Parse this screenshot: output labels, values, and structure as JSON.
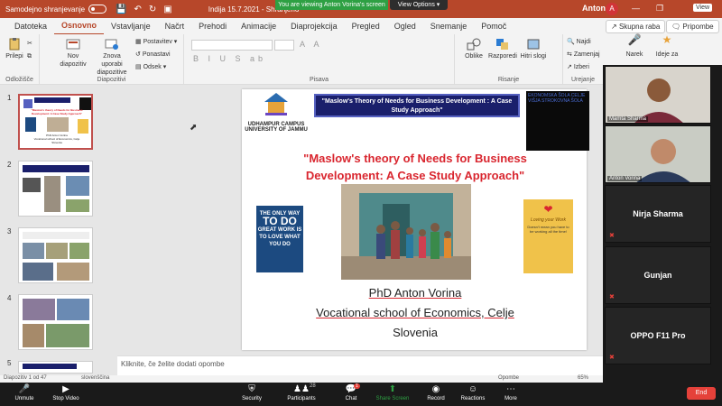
{
  "titlebar": {
    "autosave": "Samodejno shranjevanje",
    "doc_title": "Indija 15.7.2021  -  Shranjeno",
    "user": "Anton",
    "avatar": "A",
    "viewing_banner": "You are viewing Anton Vorina's screen",
    "view_options": "View Options",
    "view_btn": "View"
  },
  "tabs": [
    "Datoteka",
    "Osnovno",
    "Vstavljanje",
    "Načrt",
    "Prehodi",
    "Animacije",
    "Diaprojekcija",
    "Pregled",
    "Ogled",
    "Snemanje",
    "Pomoč"
  ],
  "active_tab": "Osnovno",
  "share_label": "Skupna raba",
  "comments_label": "Pripombe",
  "ribbon": {
    "paste": "Prilepi",
    "clipboard": "Odložišče",
    "new_slide": "Nov diapozitiv",
    "reuse": "Znova uporabi diapozitive",
    "layout": "Postavitev",
    "reset": "Ponastavi",
    "section": "Odsek",
    "slides_group": "Diapozitivi",
    "font_group": "Pisava",
    "shapes": "Oblike",
    "arrange": "Razporedi",
    "quick_styles": "Hitri slogi",
    "drawing_group": "Risanje",
    "find": "Najdi",
    "replace": "Zamenjaj",
    "select": "Izberi",
    "editing_group": "Urejanje",
    "dictate": "Narek",
    "designer": "Ideje za"
  },
  "thumbnails": {
    "numbers": [
      "1",
      "2",
      "3",
      "4",
      "5"
    ],
    "slide1_lines": [
      "\"Maslow's theory of Needs for Business",
      "Development: A Case Study Approach\"",
      "PhD Anton Vorina",
      "Vocational school of Economics, Celje",
      "Slovenia"
    ]
  },
  "slide": {
    "uni_name": "UDHAMPUR CAMPUS",
    "uni_sub": "UNIVERSITY OF JAMMU",
    "banner": "\"Maslow's Theory of Needs for Business Development : A Case Study Approach\"",
    "school_logo": "EKONOMSKA ŠOLA CELJE VIŠJA STROKOVNA ŠOLA",
    "title": "\"Maslow's theory of Needs for Business Development: A Case Study Approach\"",
    "poster_l1": "THE ONLY WAY",
    "poster_l2": "TO DO",
    "poster_l3": "GREAT WORK IS TO LOVE WHAT YOU DO",
    "card_title": "Loving your Work",
    "card_text": "Doesn't mean you have to be working all the time!",
    "author": "PhD Anton Vorina",
    "institution": "Vocational school of Economics,  Celje",
    "country": "Slovenia"
  },
  "notes_placeholder": "Kliknite, če želite dodati opombe",
  "status": {
    "slide_count": "Diapozitiv 1 od 47",
    "language": "slovenščina",
    "notes_btn": "Opombe",
    "zoom": "65%"
  },
  "participants": [
    {
      "name": "Mamta Sharma",
      "video": true
    },
    {
      "name": "Anton Vorina",
      "video": true
    },
    {
      "name": "Nirja Sharma",
      "video": false
    },
    {
      "name": "Gunjan",
      "video": false
    },
    {
      "name": "OPPO F11 Pro",
      "video": false
    }
  ],
  "zoom_toolbar": {
    "unmute": "Unmute",
    "stop_video": "Stop Video",
    "security": "Security",
    "participants": "Participants",
    "participants_count": "28",
    "chat": "Chat",
    "chat_badge": "1",
    "share_screen": "Share Screen",
    "record": "Record",
    "reactions": "Reactions",
    "more": "More",
    "end": "End"
  },
  "colors": {
    "ppt_accent": "#b7472a",
    "slide_title": "#d9262f",
    "zoom_green": "#2ea043",
    "zoom_red": "#e5413a"
  }
}
